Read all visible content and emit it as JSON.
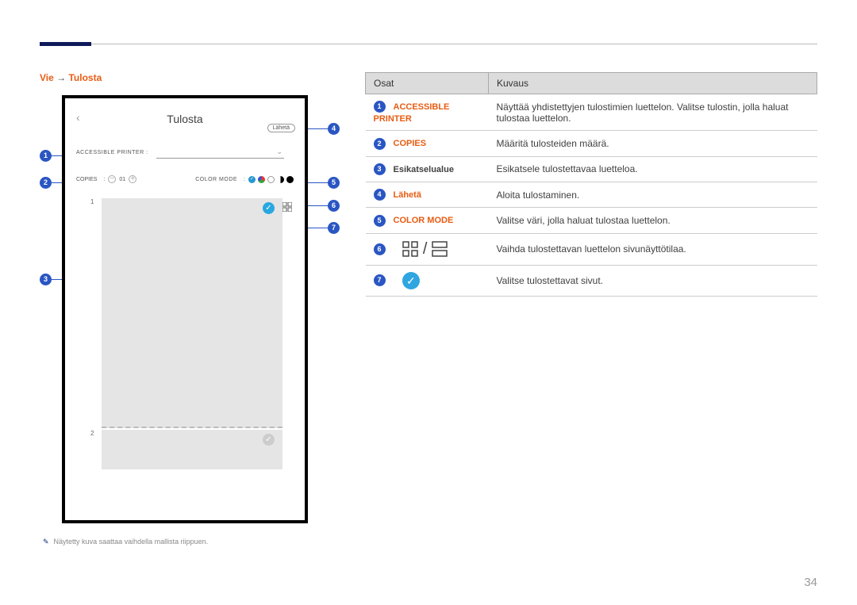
{
  "breadcrumb": {
    "part1": "Vie",
    "arrow": "→",
    "part2": "Tulosta"
  },
  "device": {
    "title": "Tulosta",
    "send_label": "Lähetä",
    "printer_label": "ACCESSIBLE PRINTER :",
    "copies_label": "COPIES",
    "copies_value": "01",
    "colormode_label": "COLOR MODE",
    "page1_num": "1",
    "page2_num": "2"
  },
  "callouts": {
    "c1": "1",
    "c2": "2",
    "c3": "3",
    "c4": "4",
    "c5": "5",
    "c6": "6",
    "c7": "7"
  },
  "footnote": "Näytetty kuva saattaa vaihdella mallista riippuen.",
  "table": {
    "header_parts": "Osat",
    "header_desc": "Kuvaus",
    "rows": [
      {
        "num": "1",
        "name": "ACCESSIBLE PRINTER",
        "red": true,
        "desc": "Näyttää yhdistettyjen tulostimien luettelon. Valitse tulostin, jolla haluat tulostaa luettelon."
      },
      {
        "num": "2",
        "name": "COPIES",
        "red": true,
        "desc": "Määritä tulosteiden määrä."
      },
      {
        "num": "3",
        "name": "Esikatselualue",
        "red": false,
        "desc": "Esikatsele tulostettavaa luetteloa."
      },
      {
        "num": "4",
        "name": "Lähetä",
        "red": true,
        "desc": "Aloita tulostaminen."
      },
      {
        "num": "5",
        "name": "COLOR MODE",
        "red": true,
        "desc": "Valitse väri, jolla haluat tulostaa luettelon."
      },
      {
        "num": "6",
        "name": "",
        "red": false,
        "desc": "Vaihda tulostettavan luettelon sivunäyttötilaa."
      },
      {
        "num": "7",
        "name": "",
        "red": false,
        "desc": "Valitse tulostettavat sivut."
      }
    ]
  },
  "page_number": "34"
}
